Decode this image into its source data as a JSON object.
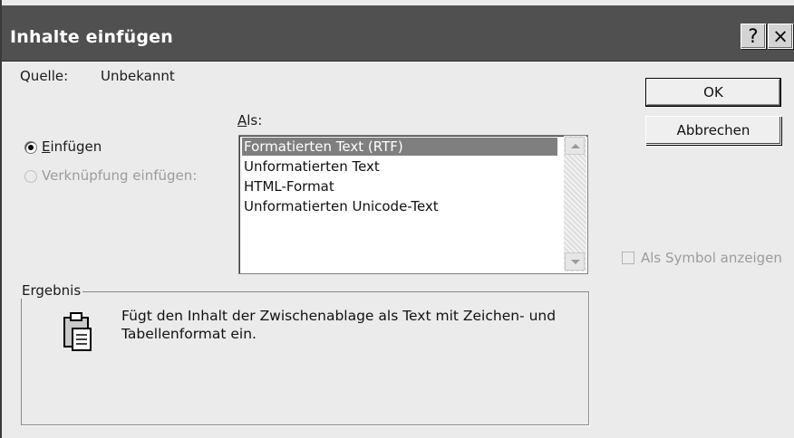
{
  "dialog": {
    "title": "Inhalte einfügen",
    "help_glyph": "?",
    "close_glyph": "×"
  },
  "source": {
    "label": "Quelle:",
    "value": "Unbekannt"
  },
  "as": {
    "label_accel": "A",
    "label_rest": "ls:"
  },
  "options": {
    "paste": {
      "accel": "E",
      "rest": "infügen",
      "selected": true
    },
    "paste_link": {
      "label": "Verknüpfung einfügen:",
      "enabled": false
    }
  },
  "formats": [
    {
      "label": "Formatierten Text (RTF)",
      "selected": true
    },
    {
      "label": "Unformatierten Text"
    },
    {
      "label": "HTML-Format"
    },
    {
      "label": "Unformatierten Unicode-Text"
    }
  ],
  "buttons": {
    "ok": "OK",
    "cancel": "Abbrechen"
  },
  "display_as_icon": {
    "label": "Als Symbol anzeigen",
    "checked": false,
    "enabled": false
  },
  "result": {
    "title": "Ergebnis",
    "text": "Fügt den Inhalt der Zwischenablage als Text mit Zeichen- und Tabellenformat ein."
  },
  "icons": {
    "help": "question-mark-icon",
    "close": "close-icon",
    "result": "clipboard-paste-icon"
  }
}
